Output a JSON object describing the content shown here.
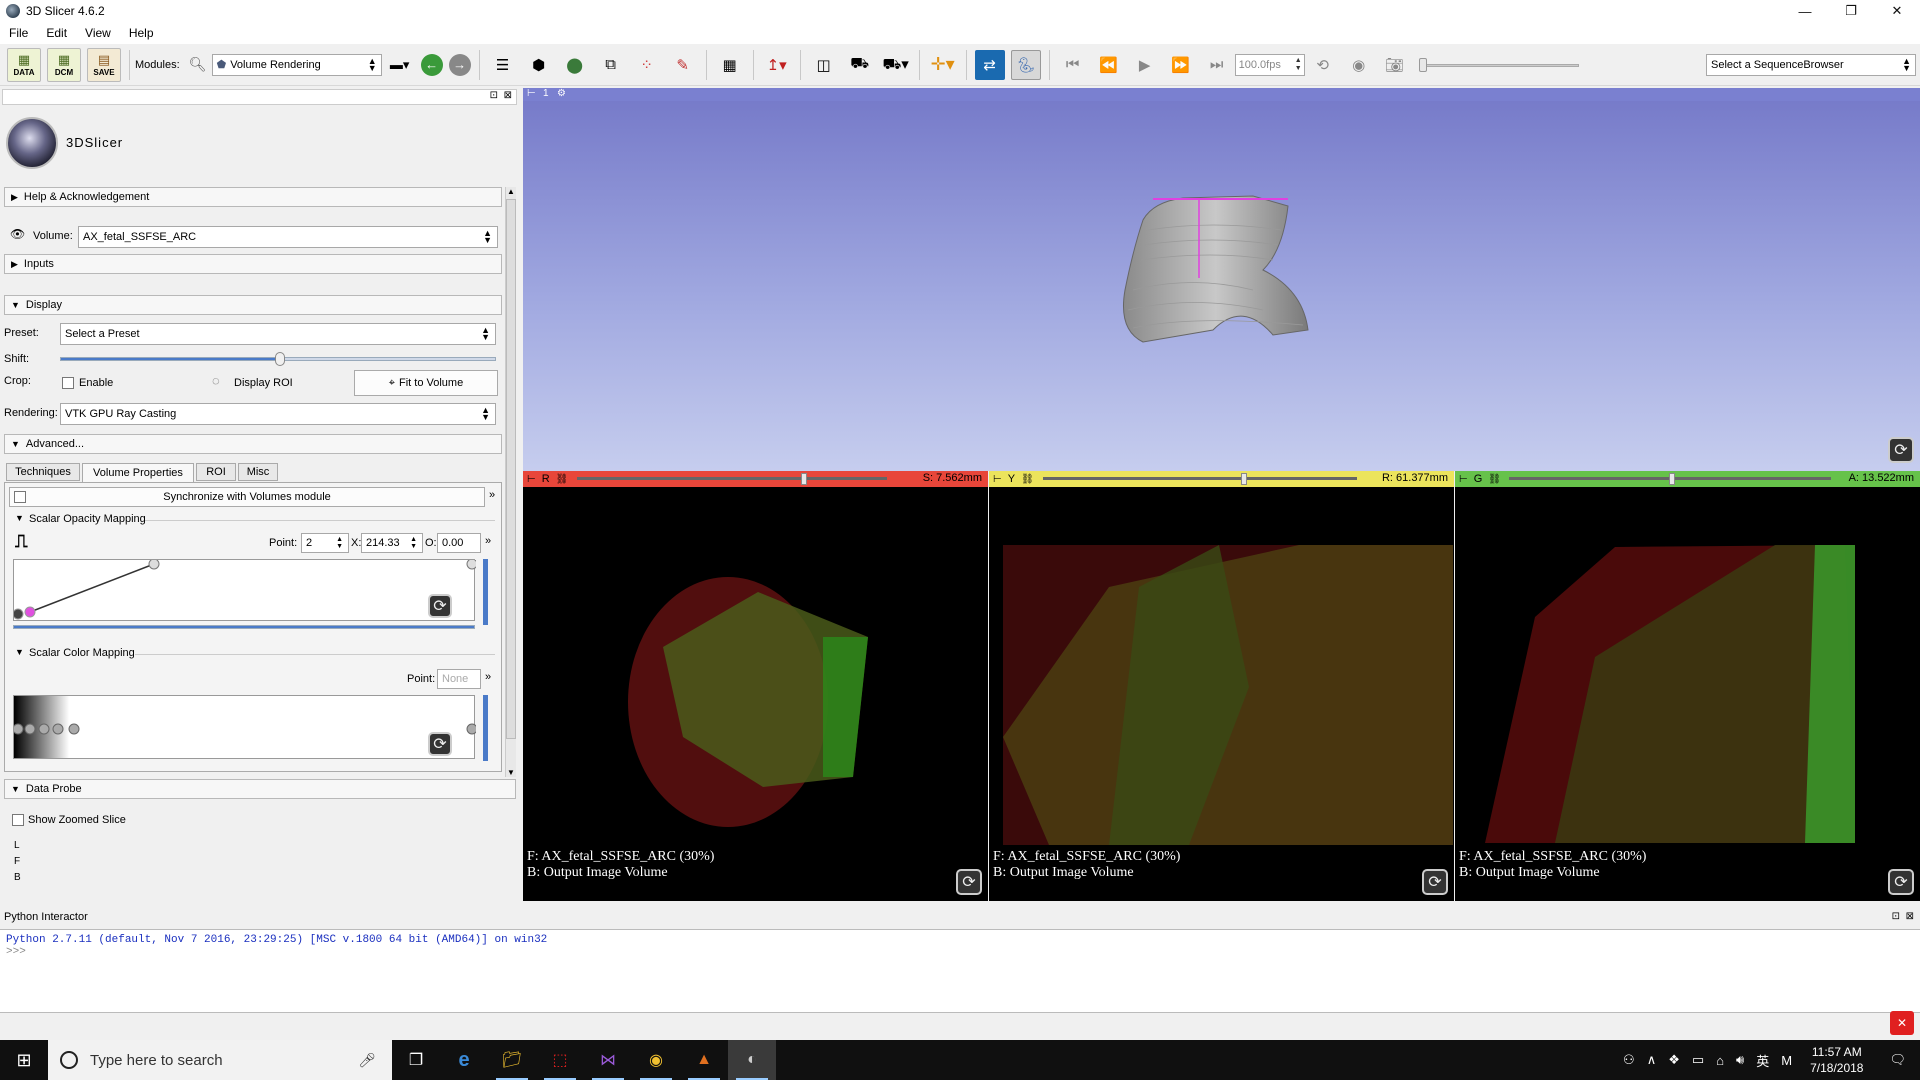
{
  "window": {
    "title": "3D Slicer 4.6.2",
    "minimize": "—",
    "maximize": "❐",
    "close": "✕"
  },
  "menu": [
    "File",
    "Edit",
    "View",
    "Help"
  ],
  "toolbar": {
    "data_label": "DATA",
    "dcm_label": "DCM",
    "save_label": "SAVE",
    "modules_label": "Modules:",
    "module_selected": "Volume Rendering",
    "fps_value": "100.0fps",
    "sequence_browser": "Select a SequenceBrowser"
  },
  "logo": {
    "text": "3DSlicer"
  },
  "panel": {
    "help_label": "Help & Acknowledgement",
    "volume_label": "Volume:",
    "volume_value": "AX_fetal_SSFSE_ARC",
    "inputs_label": "Inputs",
    "display_label": "Display",
    "preset_label": "Preset:",
    "preset_value": "Select a Preset",
    "shift_label": "Shift:",
    "crop_label": "Crop:",
    "enable_label": "Enable",
    "display_roi_label": "Display ROI",
    "fit_label": "Fit to Volume",
    "rendering_label": "Rendering:",
    "rendering_value": "VTK GPU Ray Casting",
    "advanced_label": "Advanced...",
    "tabs": [
      "Techniques",
      "Volume Properties",
      "ROI",
      "Misc"
    ],
    "sync_label": "Synchronize with Volumes module",
    "opacity_label": "Scalar Opacity Mapping",
    "point_label": "Point:",
    "point_value": "2",
    "x_label": "X:",
    "x_value": "214.33",
    "o_label": "O:",
    "o_value": "0.00",
    "color_label": "Scalar Color Mapping",
    "color_point_label": "Point:",
    "color_point_value": "None",
    "data_probe_label": "Data Probe",
    "show_zoomed_label": "Show Zoomed Slice",
    "probe_lines": [
      "L",
      "F",
      "B"
    ]
  },
  "view3d": {
    "label": "1"
  },
  "slices": [
    {
      "letter": "R",
      "value": "S: 7.562mm",
      "color": "#e8463a",
      "slider_pos": 0.67,
      "fg": "F: AX_fetal_SSFSE_ARC (30%)",
      "bg": "B: Output Image Volume"
    },
    {
      "letter": "Y",
      "value": "R: 61.377mm",
      "color": "#ece45c",
      "slider_pos": 0.6,
      "fg": "F: AX_fetal_SSFSE_ARC (30%)",
      "bg": "B: Output Image Volume"
    },
    {
      "letter": "G",
      "value": "A: 13.522mm",
      "color": "#66c24a",
      "slider_pos": 0.5,
      "fg": "F: AX_fetal_SSFSE_ARC (30%)",
      "bg": "B: Output Image Volume"
    }
  ],
  "python": {
    "title": "Python Interactor",
    "line1": "Python 2.7.11 (default, Nov  7 2016, 23:29:25) [MSC v.1800 64 bit (AMD64)] on win32",
    "line2": ">>>"
  },
  "taskbar": {
    "search_placeholder": "Type here to search",
    "time": "11:57 AM",
    "date": "7/18/2018",
    "ime": "英",
    "ime2": "M"
  }
}
